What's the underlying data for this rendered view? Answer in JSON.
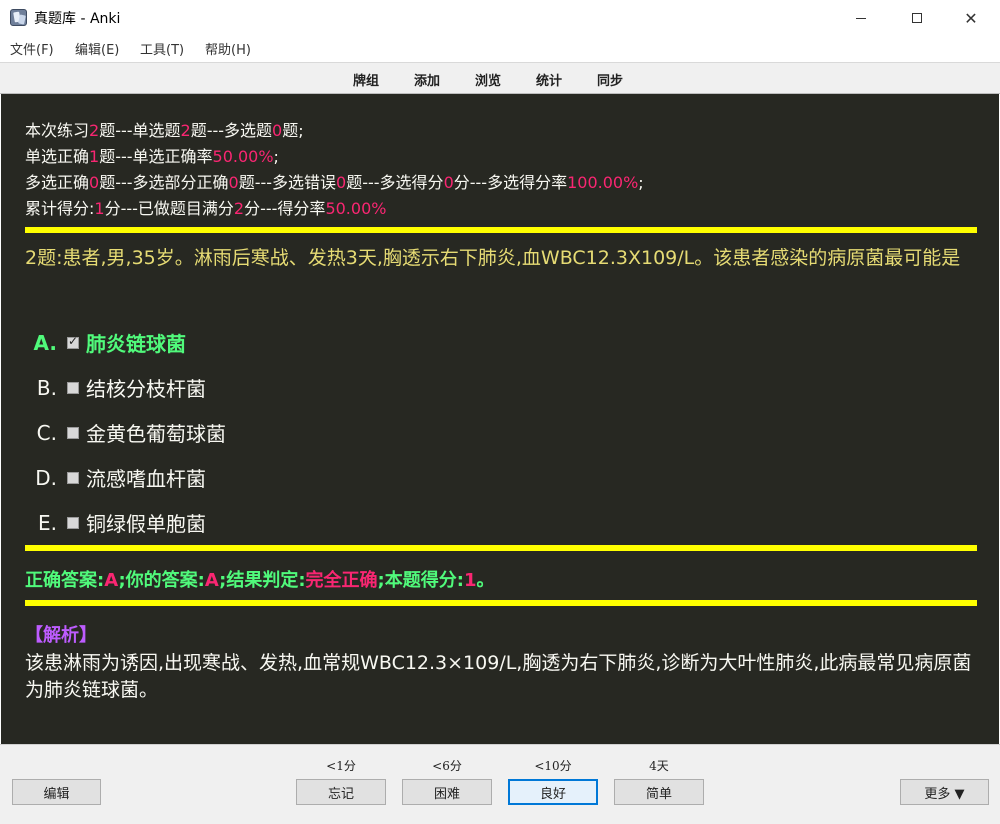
{
  "window": {
    "title": "真题库 - Anki"
  },
  "menu": [
    "文件(F)",
    "编辑(E)",
    "工具(T)",
    "帮助(H)"
  ],
  "toolbar": [
    "牌组",
    "添加",
    "浏览",
    "统计",
    "同步"
  ],
  "stats": {
    "line1": [
      "本次练习",
      "2",
      "题---单选题",
      "2",
      "题---多选题",
      "0",
      "题;"
    ],
    "line2": [
      "单选正确",
      "1",
      "题---单选正确率",
      "50.00%",
      ";"
    ],
    "line3": [
      "多选正确",
      "0",
      "题---多选部分正确",
      "0",
      "题---多选错误",
      "0",
      "题---多选得分",
      "0",
      "分---多选得分率",
      "100.00%",
      ";"
    ],
    "line4": [
      "累计得分:",
      "1",
      "分---已做题目满分",
      "2",
      "分---得分率",
      "50.00%"
    ]
  },
  "question": "2题:患者,男,35岁。淋雨后寒战、发热3天,胸透示右下肺炎,血WBC12.3X109/L。该患者感染的病原菌最可能是",
  "options": [
    {
      "letter": "A.",
      "text": "肺炎链球菌",
      "checked": true
    },
    {
      "letter": "B.",
      "text": "结核分枝杆菌",
      "checked": false
    },
    {
      "letter": "C.",
      "text": "金黄色葡萄球菌",
      "checked": false
    },
    {
      "letter": "D.",
      "text": "流感嗜血杆菌",
      "checked": false
    },
    {
      "letter": "E.",
      "text": "铜绿假单胞菌",
      "checked": false
    }
  ],
  "result": {
    "correct_label": "正确答案:",
    "correct_value": "A",
    "your_label": ";你的答案:",
    "your_value": "A",
    "verdict_label": ";结果判定:",
    "verdict_value": "完全正确",
    "score_label": ";本题得分:",
    "score_value": "1",
    "end": "。"
  },
  "analysis": {
    "title": "【解析】",
    "text": "该患淋雨为诱因,出现寒战、发热,血常规WBC12.3×109/L,胸透为右下肺炎,诊断为大叶性肺炎,此病最常见病原菌为肺炎链球菌。"
  },
  "bottom": {
    "edit": "编辑",
    "more": "更多 ▼",
    "answers": [
      {
        "interval": "<1分",
        "label": "忘记"
      },
      {
        "interval": "<6分",
        "label": "困难"
      },
      {
        "interval": "<10分",
        "label": "良好"
      },
      {
        "interval": "4天",
        "label": "简单"
      }
    ]
  },
  "colors": {
    "card_bg": "#272822",
    "highlight": "#f92672",
    "correct": "#50fa7b",
    "question": "#e6db74",
    "rule": "#ffff00",
    "analysis_title": "#bd5cff"
  }
}
